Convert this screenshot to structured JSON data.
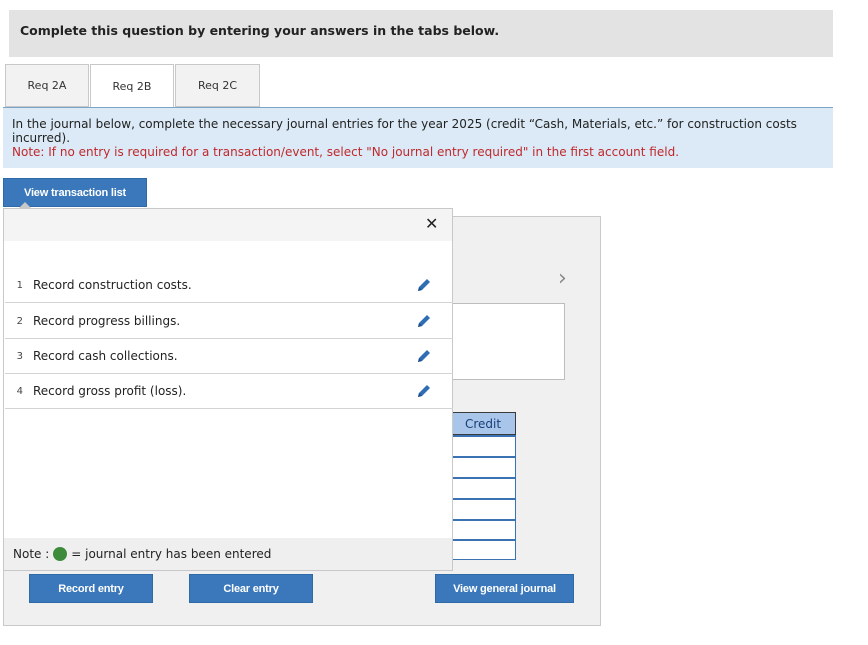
{
  "header": {
    "title": "Complete this question by entering your answers in the tabs below."
  },
  "tabs": [
    {
      "label": "Req 2A",
      "active": false
    },
    {
      "label": "Req 2B",
      "active": true
    },
    {
      "label": "Req 2C",
      "active": false
    }
  ],
  "instructions": {
    "text": "In the journal below, complete the necessary journal entries for the year 2025 (credit “Cash, Materials, etc.” for construction costs incurred).",
    "note": "Note: If no entry is required for a transaction/event, select \"No journal entry required\" in the first account field."
  },
  "buttons": {
    "view_transaction_list": "View transaction list",
    "record_entry": "Record entry",
    "clear_entry": "Clear entry",
    "view_general_journal": "View general journal"
  },
  "popup": {
    "close_glyph": "✕",
    "transactions": [
      {
        "num": "1",
        "label": "Record construction costs."
      },
      {
        "num": "2",
        "label": "Record progress billings."
      },
      {
        "num": "3",
        "label": "Record cash collections."
      },
      {
        "num": "4",
        "label": "Record gross profit (loss)."
      }
    ],
    "note_prefix": "Note :",
    "note_suffix": "= journal entry has been entered"
  },
  "journal": {
    "credit_header": "Credit",
    "chevron": "›"
  },
  "colors": {
    "button_blue": "#3a78bb",
    "instruction_bg": "#dbeaf6",
    "note_red": "#c0282b",
    "entered_dot_green": "#3c8c3c",
    "credit_header_bg": "#a9c5ea"
  },
  "icons": {
    "edit": "pencil-icon",
    "close": "close-icon",
    "next": "chevron-right-icon",
    "entered": "green-dot-icon"
  }
}
